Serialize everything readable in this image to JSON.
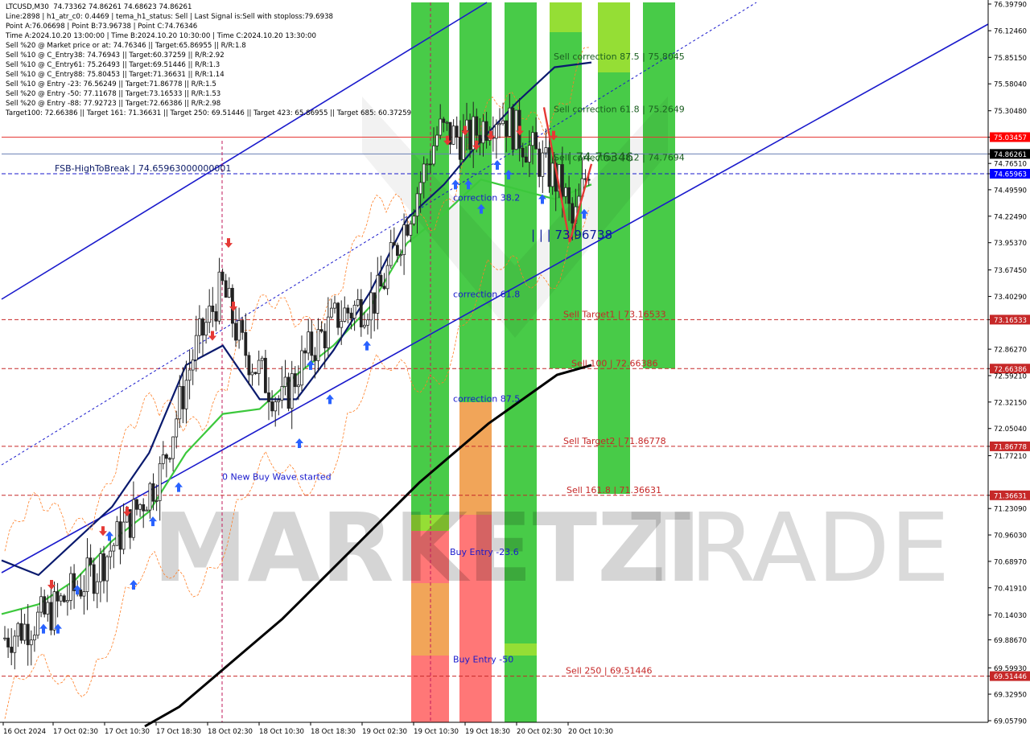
{
  "info_panel": [
    "LTCUSD,M30  74.73362 74.86261 74.68623 74.86261",
    "Line:2898 | h1_atr_c0: 0.4469 | tema_h1_status: Sell | Last Signal is:Sell with stoploss:79.6938",
    "Point A:76.06698 | Point B:73.96738 | Point C:74.76346",
    "Time A:2024.10.20 13:00:00 | Time B:2024.10.20 10:30:00 | Time C:2024.10.20 13:30:00",
    "Sell %20 @ Market price or at: 74.76346 || Target:65.86955 || R/R:1.8",
    "Sell %10 @ C_Entry38: 74.76943 || Target:60.37259 || R/R:2.92",
    "Sell %10 @ C_Entry61: 75.26493 || Target:69.51446 || R/R:1.3",
    "Sell %10 @ C_Entry88: 75.80453 || Target:71.36631 || R/R:1.14",
    "Sell %10 @ Entry -23: 76.56249 || Target:71.86778 || R/R:1.5",
    "Sell %20 @ Entry -50: 77.11678 || Target:73.16533 || R/R:1.53",
    "Sell %20 @ Entry -88: 77.92723 || Target:72.66386 || R/R:2.98",
    "Target100: 72.66386 || Target 161: 71.36631 || Target 250: 69.51446 || Target 423: 65.86955 || Target 685: 60.37259"
  ],
  "chart_data": {
    "type": "line",
    "symbol": "LTCUSD,M30",
    "ylim": [
      69.0579,
      76.3979
    ],
    "price_ticks": [
      "76.39790",
      "76.12460",
      "75.85150",
      "75.58040",
      "75.30480",
      "75.03457",
      "74.86261",
      "74.76510",
      "74.65963",
      "74.49590",
      "74.22490",
      "73.95370",
      "73.67450",
      "73.40290",
      "73.16533",
      "72.86270",
      "72.66386",
      "72.59210",
      "72.32150",
      "72.05040",
      "71.86778",
      "71.77210",
      "71.36631",
      "71.23090",
      "70.96030",
      "70.68970",
      "70.41910",
      "70.14030",
      "69.88670",
      "69.59930",
      "69.51446",
      "69.32950",
      "69.05790"
    ],
    "highlighted_ticks": [
      {
        "value": 75.03457,
        "label": "75.03457",
        "color": "#ff0000"
      },
      {
        "value": 74.86261,
        "label": "74.86261",
        "color": "#000000"
      },
      {
        "value": 74.65963,
        "label": "74.65963",
        "color": "#0000ff"
      },
      {
        "value": 73.16533,
        "label": "73.16533",
        "color": "#c62828"
      },
      {
        "value": 72.66386,
        "label": "72.66386",
        "color": "#c62828"
      },
      {
        "value": 71.86778,
        "label": "71.86778",
        "color": "#c62828"
      },
      {
        "value": 71.36631,
        "label": "71.36631",
        "color": "#c62828"
      },
      {
        "value": 69.51446,
        "label": "69.51446",
        "color": "#c62828"
      }
    ],
    "time_labels": [
      "16 Oct 2024",
      "17 Oct 02:30",
      "17 Oct 10:30",
      "17 Oct 18:30",
      "18 Oct 02:30",
      "18 Oct 10:30",
      "18 Oct 18:30",
      "19 Oct 02:30",
      "19 Oct 10:30",
      "19 Oct 18:30",
      "20 Oct 02:30",
      "20 Oct 10:30"
    ],
    "levels": [
      {
        "value": 75.03457,
        "color": "#e53935",
        "dash": false
      },
      {
        "value": 74.86261,
        "color": "#6a7fb5",
        "dash": false
      },
      {
        "value": 74.65963,
        "color": "#1a1acc",
        "dash": true
      },
      {
        "value": 73.16533,
        "color": "#c62828",
        "dash": true
      },
      {
        "value": 72.66386,
        "color": "#c62828",
        "dash": true
      },
      {
        "value": 71.86778,
        "color": "#c62828",
        "dash": true
      },
      {
        "value": 71.36631,
        "color": "#c62828",
        "dash": true
      },
      {
        "value": 69.51446,
        "color": "#c62828",
        "dash": true
      }
    ],
    "annotations": [
      {
        "text": "FSB-HighToBreak  |  74.65963000000001",
        "value": 74.65963,
        "color": "#0b1a66"
      },
      {
        "text": "Sell correction 87.5 | 75.8045",
        "value": 75.8045,
        "color": "#1b5e20"
      },
      {
        "text": "Sell correction 61.8 | 75.2649",
        "value": 75.2649,
        "color": "#1b5e20"
      },
      {
        "text": "Sell correction 38.2 | 74.7694",
        "value": 74.7694,
        "color": "#1b5e20"
      },
      {
        "text": "| | | 74.76346",
        "value": 74.76346,
        "color": "#1b5e20"
      },
      {
        "text": "| | | 73.96738",
        "value": 73.96738,
        "color": "#0b1a99"
      },
      {
        "text": "correction 38.2",
        "value": 74.36,
        "color": "#1a1acc"
      },
      {
        "text": "correction 61.8",
        "value": 73.37,
        "color": "#1a1acc"
      },
      {
        "text": "correction 87.5",
        "value": 72.3,
        "color": "#1a1acc"
      },
      {
        "text": "Sell Target1 | 73.16533",
        "value": 73.16533,
        "color": "#c62828"
      },
      {
        "text": "Sell 100 | 72.66386",
        "value": 72.66386,
        "color": "#c62828"
      },
      {
        "text": "Sell Target2 | 71.86778",
        "value": 71.86778,
        "color": "#c62828"
      },
      {
        "text": "Sell 161.8 | 71.36631",
        "value": 71.36631,
        "color": "#c62828"
      },
      {
        "text": "Sell 250 | 69.51446",
        "value": 69.51446,
        "color": "#c62828"
      },
      {
        "text": "Buy Entry -23.6",
        "value": 70.73,
        "color": "#1a1acc"
      },
      {
        "text": "Buy Entry -50",
        "value": 69.63,
        "color": "#1a1acc"
      },
      {
        "text": "0 New Buy Wave started",
        "value": 71.5,
        "color": "#1a1acc"
      }
    ],
    "series": [
      {
        "name": "",
        "color": "#000000",
        "values": [
          69.0,
          69.2,
          69.5,
          69.8,
          70.1,
          70.45,
          70.8,
          71.15,
          71.5,
          71.8,
          72.1,
          72.35,
          72.6,
          72.7
        ]
      },
      {
        "name": "",
        "color": "#3cc83c",
        "values": [
          70.15,
          70.25,
          70.5,
          70.9,
          71.2,
          71.8,
          72.2,
          72.25,
          72.6,
          72.9,
          73.3,
          73.95,
          74.25,
          74.6,
          74.5,
          74.4,
          74.55
        ]
      },
      {
        "name": "",
        "color": "#0a1a6e",
        "values": [
          70.7,
          70.55,
          70.9,
          71.25,
          71.8,
          72.7,
          72.9,
          72.35,
          72.35,
          72.85,
          73.45,
          74.2,
          74.55,
          75.0,
          75.4,
          75.75,
          75.8
        ]
      }
    ]
  },
  "watermark": {
    "brand_bold": "MARKETZI",
    "brand_light": "TRADE"
  },
  "colors": {
    "zone_green": "#3ec83e",
    "zone_light_green": "#8fdc2a",
    "zone_orange": "#f0a050",
    "zone_red": "#ff7070",
    "bull": "#2962ff",
    "bear": "#e53935"
  }
}
